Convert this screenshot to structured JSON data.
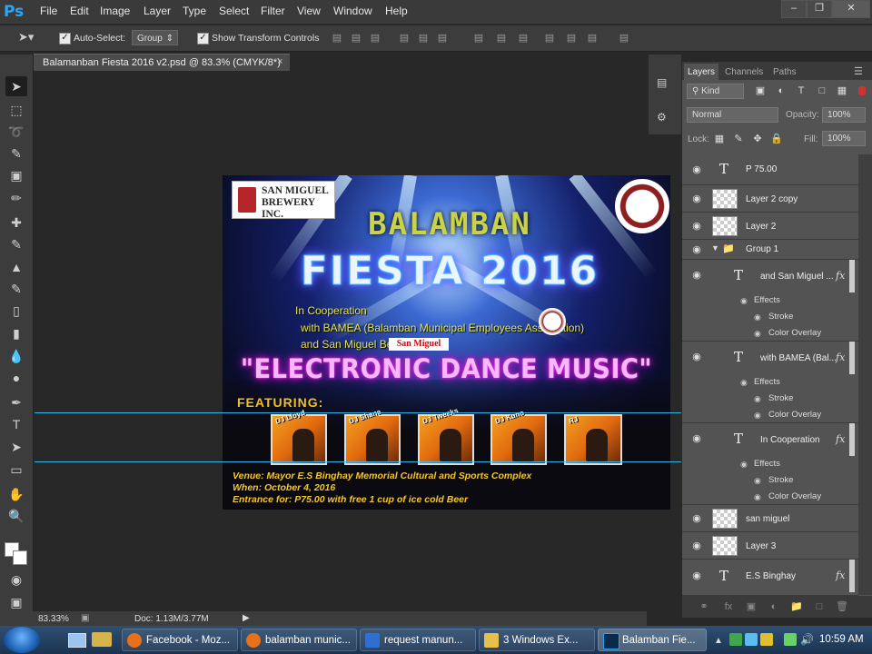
{
  "menubar": {
    "app_logo": "Ps",
    "items": [
      "File",
      "Edit",
      "Image",
      "Layer",
      "Type",
      "Select",
      "Filter",
      "View",
      "Window",
      "Help"
    ]
  },
  "options_bar": {
    "auto_select_label": "Auto-Select:",
    "auto_select_value": "Group",
    "show_transform_label": "Show Transform Controls"
  },
  "document": {
    "tab_title": "Balamanban Fiesta 2016 v2.psd @ 83.3% (CMYK/8*)",
    "close_glyph": "×"
  },
  "poster": {
    "sponsor_logo_text": "SAN MIGUEL BREWERY INC.",
    "headline_1": "BALAMBAN",
    "headline_2": "FIESTA 2016",
    "coop_lines": [
      "In Cooperation",
      "with BAMEA (Balamban Municipal Employees Association)",
      "and San Miguel Beer"
    ],
    "coop_logo_text": "San Miguel",
    "event_title": "\"ELECTRONIC DANCE MUSIC\"",
    "featuring_label": "FEATURING:",
    "djs": [
      "DJ Lloyd",
      "DJ Shane",
      "DJ Tweeks",
      "DJ Kuno",
      "RJ"
    ],
    "venue": "Venue: Mayor E.S Binghay Memorial Cultural and Sports Complex",
    "when": "When: October 4, 2016",
    "entrance": "Entrance for: P75.00 with free 1 cup of ice cold Beer"
  },
  "status_bar": {
    "zoom": "83.33%",
    "doc_size": "Doc: 1.13M/3.77M"
  },
  "layers_panel": {
    "tabs": [
      "Layers",
      "Channels",
      "Paths"
    ],
    "active_tab": "Layers",
    "filter_label": "Kind",
    "blend_mode": "Normal",
    "opacity_label": "Opacity:",
    "opacity_value": "100%",
    "lock_label": "Lock:",
    "fill_label": "Fill:",
    "fill_value": "100%",
    "effects_label": "Effects",
    "stroke_label": "Stroke",
    "color_overlay_label": "Color Overlay",
    "layers": [
      {
        "name": "P 75.00",
        "kind": "text"
      },
      {
        "name": "Layer 2 copy",
        "kind": "pixel"
      },
      {
        "name": "Layer 2",
        "kind": "pixel"
      },
      {
        "name": "Group 1",
        "kind": "group"
      },
      {
        "name": "and San Miguel ...",
        "kind": "text",
        "fx": true
      },
      {
        "name": "with BAMEA (Bal...",
        "kind": "text",
        "fx": true
      },
      {
        "name": "In Cooperation",
        "kind": "text",
        "fx": true
      },
      {
        "name": "san miguel",
        "kind": "pixel"
      },
      {
        "name": "Layer 3",
        "kind": "pixel"
      },
      {
        "name": "E.S Binghay",
        "kind": "text",
        "fx": true
      }
    ]
  },
  "taskbar": {
    "items": [
      {
        "label": "Facebook - Moz...",
        "color": "#e8701a"
      },
      {
        "label": "balamban munic...",
        "color": "#e8701a"
      },
      {
        "label": "request manun...",
        "color": "#2f6fd0"
      },
      {
        "label": "3 Windows Ex...",
        "color": "#e6c04a"
      },
      {
        "label": "Balamban Fie...",
        "color": "#2fa3f5"
      }
    ],
    "clock": "10:59 AM"
  },
  "colors": {
    "ps_blue": "#2fa3f5",
    "guide": "#37c6ff",
    "poster_yellow": "#f4c72a",
    "neon_pink": "#ff2dd8"
  }
}
